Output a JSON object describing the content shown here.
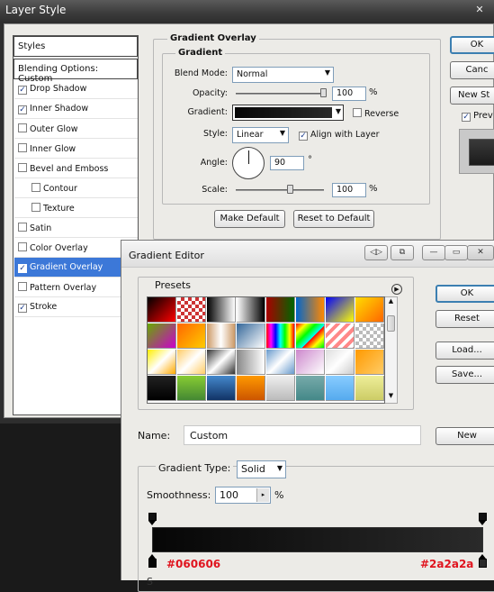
{
  "layer_style": {
    "title": "Layer Style",
    "styles_header": "Styles",
    "blending_options": "Blending Options: Custom",
    "items": [
      {
        "label": "Drop Shadow",
        "checked": true,
        "sub": false
      },
      {
        "label": "Inner Shadow",
        "checked": true,
        "sub": false
      },
      {
        "label": "Outer Glow",
        "checked": false,
        "sub": false
      },
      {
        "label": "Inner Glow",
        "checked": false,
        "sub": false
      },
      {
        "label": "Bevel and Emboss",
        "checked": false,
        "sub": false
      },
      {
        "label": "Contour",
        "checked": false,
        "sub": true
      },
      {
        "label": "Texture",
        "checked": false,
        "sub": true
      },
      {
        "label": "Satin",
        "checked": false,
        "sub": false
      },
      {
        "label": "Color Overlay",
        "checked": false,
        "sub": false
      },
      {
        "label": "Gradient Overlay",
        "checked": true,
        "sub": false,
        "selected": true
      },
      {
        "label": "Pattern Overlay",
        "checked": false,
        "sub": false
      },
      {
        "label": "Stroke",
        "checked": true,
        "sub": false
      }
    ],
    "section_title": "Gradient Overlay",
    "group_title": "Gradient",
    "blend_mode_label": "Blend Mode:",
    "blend_mode": "Normal",
    "opacity_label": "Opacity:",
    "opacity": "100",
    "percent": "%",
    "gradient_label": "Gradient:",
    "reverse_label": "Reverse",
    "style_label": "Style:",
    "style": "Linear",
    "align_label": "Align with Layer",
    "angle_label": "Angle:",
    "angle": "90",
    "degree": "°",
    "scale_label": "Scale:",
    "scale": "100",
    "make_default": "Make Default",
    "reset_default": "Reset to Default",
    "ok": "OK",
    "cancel": "Canc",
    "new_style": "New St",
    "preview": "Prev"
  },
  "gradient_editor": {
    "title": "Gradient Editor",
    "presets_label": "Presets",
    "ok": "OK",
    "reset": "Reset",
    "load": "Load...",
    "save": "Save...",
    "name_label": "Name:",
    "name_value": "Custom",
    "new": "New",
    "gradient_type_label": "Gradient Type:",
    "gradient_type": "Solid",
    "smoothness_label": "Smoothness:",
    "smoothness": "100",
    "percent": "%",
    "stop_left": "#060606",
    "stop_right": "#2a2a2a",
    "color_left": "#060606",
    "color_right": "#2a2a2a",
    "annotation_color": "#e0141e"
  },
  "colors": {
    "selection": "#3c78d8",
    "window_bg": "#ecebe7"
  }
}
